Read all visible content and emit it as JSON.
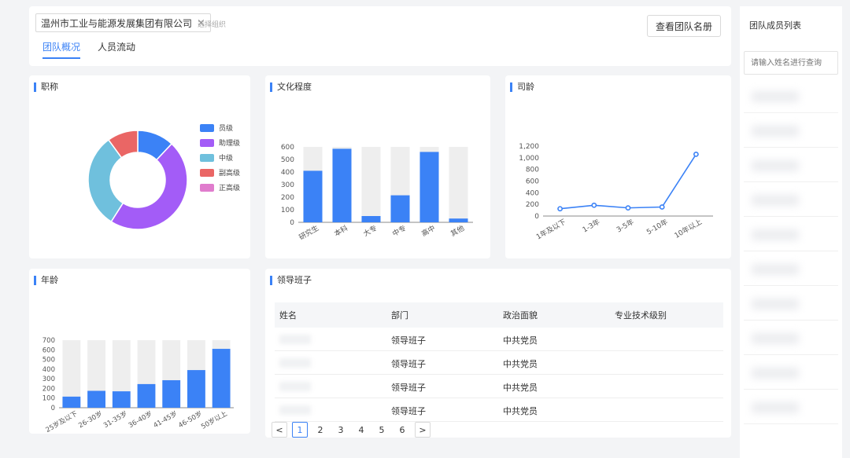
{
  "header": {
    "org_tag": "温州市工业与能源发展集团有限公司",
    "org_close": "×",
    "org_hint": "选择组织",
    "tabs": [
      {
        "label": "团队概况",
        "active": true
      },
      {
        "label": "人员流动",
        "active": false
      }
    ],
    "view_roster_button": "查看团队名册"
  },
  "cards": {
    "title_card": "职称",
    "education_card": "文化程度",
    "tenure_card": "司龄",
    "age_card": "年龄",
    "leadership_card": "领导班子"
  },
  "chart_data": [
    {
      "type": "pie",
      "title": "职称",
      "donut": true,
      "categories": [
        "员级",
        "助理级",
        "中级",
        "副高级",
        "正高级"
      ],
      "values": [
        12,
        47,
        31,
        10,
        0
      ],
      "colors": [
        "#3b82f6",
        "#a35cf7",
        "#6fc0dd",
        "#ea6665",
        "#e07ccd"
      ],
      "legend_position": "right"
    },
    {
      "type": "bar",
      "title": "文化程度",
      "categories": [
        "研究生",
        "本科",
        "大专",
        "中专",
        "高中",
        "其他"
      ],
      "values": [
        410,
        585,
        50,
        215,
        560,
        30
      ],
      "background_max": 600,
      "ylim": [
        0,
        600
      ],
      "yticks": [
        0,
        100,
        200,
        300,
        400,
        500,
        600
      ],
      "color": "#3b82f6"
    },
    {
      "type": "line",
      "title": "司龄",
      "categories": [
        "1年及以下",
        "1-3年",
        "3-5年",
        "5-10年",
        "10年以上"
      ],
      "values": [
        125,
        185,
        140,
        155,
        1060
      ],
      "ylim": [
        0,
        1200
      ],
      "yticks": [
        "0",
        "200",
        "400",
        "600",
        "800",
        "1,000",
        "1,200"
      ],
      "color": "#3b82f6"
    },
    {
      "type": "bar",
      "title": "年龄",
      "categories": [
        "25岁及以下",
        "26-30岁",
        "31-35岁",
        "36-40岁",
        "41-45岁",
        "46-50岁",
        "50岁以上"
      ],
      "values": [
        115,
        175,
        170,
        245,
        285,
        390,
        610
      ],
      "background_max": 700,
      "ylim": [
        0,
        700
      ],
      "yticks": [
        0,
        100,
        200,
        300,
        400,
        500,
        600,
        700
      ],
      "color": "#3b82f6"
    }
  ],
  "leadership_table": {
    "columns": [
      "姓名",
      "部门",
      "政治面貌",
      "专业技术级别"
    ],
    "rows": [
      {
        "department": "领导班子",
        "party": "中共党员"
      },
      {
        "department": "领导班子",
        "party": "中共党员"
      },
      {
        "department": "领导班子",
        "party": "中共党员"
      },
      {
        "department": "领导班子",
        "party": "中共党员"
      }
    ],
    "pager": {
      "prev": "<",
      "pages": [
        "1",
        "2",
        "3",
        "4",
        "5",
        "6"
      ],
      "current": "1",
      "next": ">"
    }
  },
  "side_panel": {
    "title": "团队成员列表",
    "search_placeholder": "请输入姓名进行查询"
  }
}
